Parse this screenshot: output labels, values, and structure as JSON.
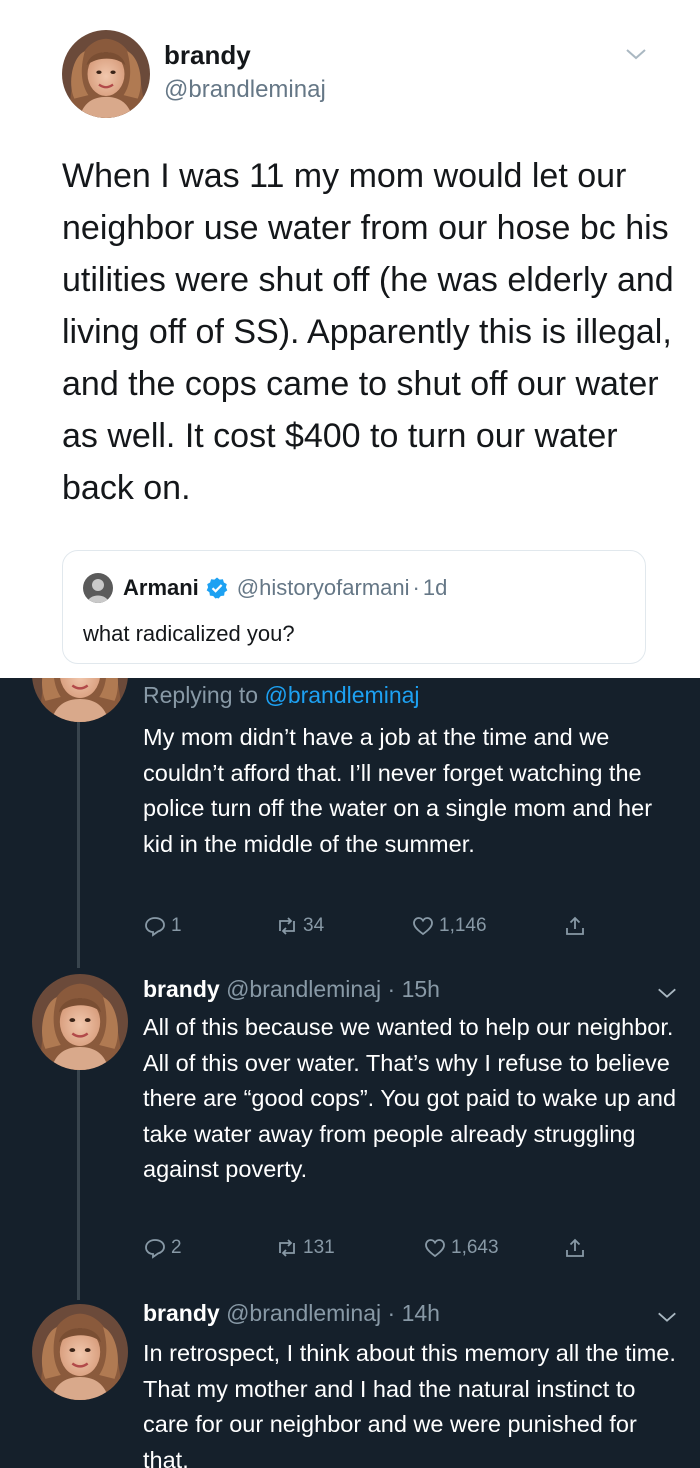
{
  "main_tweet": {
    "author_name": "brandy",
    "author_handle": "@brandleminaj",
    "text": "When I was 11 my mom would let our neighbor use water from our hose bc his utilities were shut off (he was elderly and living off of SS). Apparently this is illegal, and the cops came to shut off our water as well. It cost $400 to turn our water back on.",
    "icons": [
      "avatar",
      "chevron-down-icon"
    ]
  },
  "quoted_tweet": {
    "author_name": "Armani",
    "author_handle": "@historyofarmani",
    "separator": "·",
    "time": "1d",
    "text": "what radicalized you?",
    "icons": [
      "verified-badge-icon"
    ]
  },
  "thread": [
    {
      "reply_prefix": "Replying to ",
      "reply_handle": "@brandleminaj",
      "text": "My mom didn’t have a job at the time and we couldn’t afford that. I’ll never forget watching the police turn off the water on a single mom and her kid in the middle of the summer.",
      "replies": "1",
      "retweets": "34",
      "likes": "1,146"
    },
    {
      "author_name": "brandy",
      "author_handle": "@brandleminaj",
      "separator": "·",
      "time": "15h",
      "text": "All of this because we wanted to help our neighbor. All of this over water. That’s why I refuse to believe there are “good cops”. You got paid to wake up and take water away from people already struggling against poverty.",
      "replies": "2",
      "retweets": "131",
      "likes": "1,643"
    },
    {
      "author_name": "brandy",
      "author_handle": "@brandleminaj",
      "separator": "·",
      "time": "14h",
      "text": "In retrospect, I think about this memory all the time. That my mother and I had the natural instinct to care for our neighbor and we were punished for that."
    }
  ],
  "action_icons": [
    "reply-icon",
    "retweet-icon",
    "like-icon",
    "share-icon"
  ],
  "colors": {
    "light_bg": "#ffffff",
    "dark_bg": "#15202b",
    "link_blue": "#1da1f2",
    "muted_light": "#657786",
    "muted_dark": "#8899a6"
  }
}
